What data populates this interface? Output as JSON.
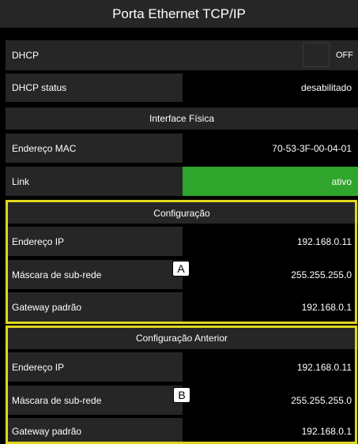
{
  "title": "Porta Ethernet TCP/IP",
  "dhcp": {
    "label": "DHCP",
    "state": "OFF"
  },
  "dhcp_status": {
    "label": "DHCP status",
    "value": "desabilitado"
  },
  "interface": {
    "heading": "Interface Física",
    "mac_label": "Endereço MAC",
    "mac_value": "70-53-3F-00-04-01",
    "link_label": "Link",
    "link_value": "ativo",
    "link_color": "#2fa52c"
  },
  "config": {
    "heading": "Configuração",
    "ip_label": "Endereço IP",
    "ip_value": "192.168.0.11",
    "mask_label": "Máscara de sub-rede",
    "mask_value": "255.255.255.0",
    "gw_label": "Gateway padrão",
    "gw_value": "192.168.0.1",
    "marker": "A"
  },
  "prev_config": {
    "heading": "Configuração Anterior",
    "ip_label": "Endereço IP",
    "ip_value": "192.168.0.11",
    "mask_label": "Máscara de sub-rede",
    "mask_value": "255.255.255.0",
    "gw_label": "Gateway padrão",
    "gw_value": "192.168.0.1",
    "marker": "B"
  },
  "highlight_color": "#e0d61e"
}
